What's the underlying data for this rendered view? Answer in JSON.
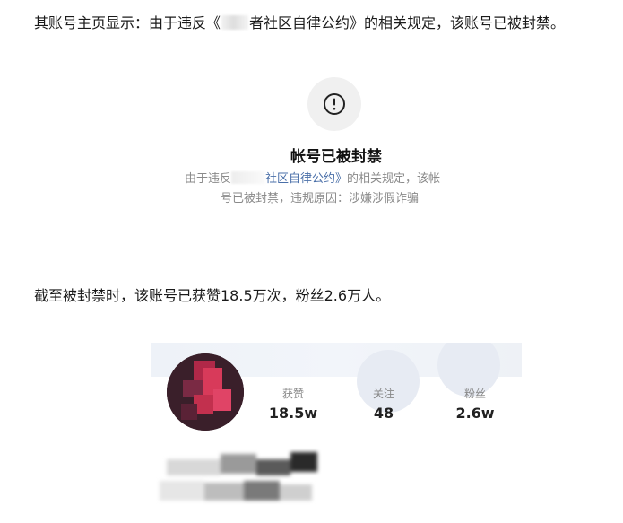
{
  "article": {
    "para1_prefix": "其账号主页显示：由于违反《",
    "para1_suffix": "者社区自律公约》的相关规定，该账号已被封禁。",
    "para2": "截至被封禁时，该账号已获赞18.5万次，粉丝2.6万人。"
  },
  "notice": {
    "icon": "exclamation-circle-icon",
    "title": "帐号已被封禁",
    "desc_line1_prefix": "由于违反",
    "desc_line1_link": "社区自律公约》",
    "desc_line1_suffix": "的相关规定，该帐",
    "desc_line2": "号已被封禁，违规原因：涉嫌涉假诈骗"
  },
  "profile": {
    "stats": [
      {
        "label": "获赞",
        "value": "18.5w"
      },
      {
        "label": "关注",
        "value": "48"
      },
      {
        "label": "粉丝",
        "value": "2.6w"
      }
    ]
  },
  "colors": {
    "link": "#4a6fa8",
    "muted_text": "#8a8a8a",
    "icon_bg": "#f0f0f0"
  }
}
